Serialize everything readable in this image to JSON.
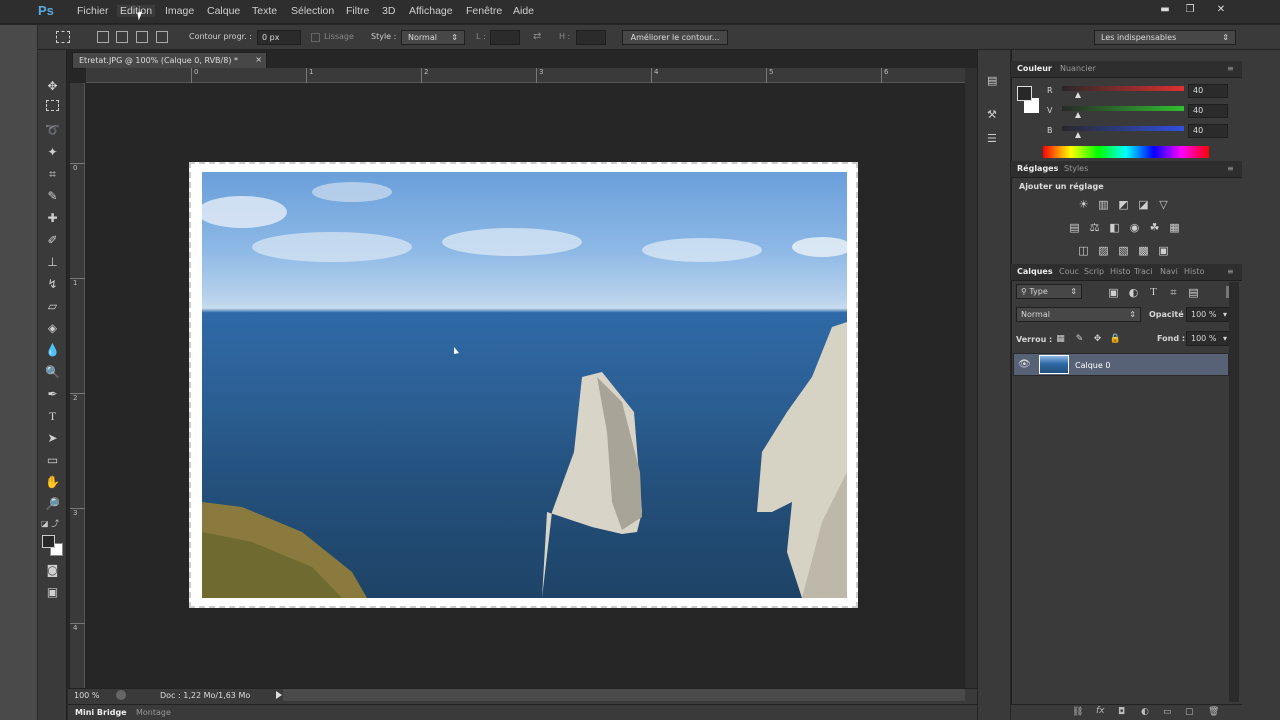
{
  "app": {
    "logo": "Ps"
  },
  "menu": [
    "Fichier",
    "Edition",
    "Image",
    "Calque",
    "Texte",
    "Sélection",
    "Filtre",
    "3D",
    "Affichage",
    "Fenêtre",
    "Aide"
  ],
  "window_controls": {
    "minimize": "▬",
    "restore": "❐",
    "close": "✕"
  },
  "options_bar": {
    "contour_label": "Contour progr. :",
    "contour_value": "0 px",
    "lissage_label": "Lissage",
    "style_label": "Style :",
    "style_value": "Normal",
    "l_label": "L :",
    "h_label": "H :",
    "refine_button": "Améliorer le contour...",
    "workspace_value": "Les indispensables"
  },
  "document": {
    "tab_title": "Etretat.JPG @ 100% (Calque 0, RVB/8) *",
    "tab_close": "×",
    "ruler_h": [
      "0",
      "1",
      "2",
      "3",
      "4",
      "5",
      "6"
    ],
    "ruler_v": [
      "0",
      "1",
      "2",
      "3",
      "4"
    ],
    "zoom": "100 %",
    "doc_info": "Doc : 1,22 Mo/1,63 Mo"
  },
  "bottom_tabs": [
    "Mini Bridge",
    "Montage"
  ],
  "color_panel": {
    "tabs": [
      "Couleur",
      "Nuancier"
    ],
    "channels": [
      {
        "label": "R",
        "value": "40",
        "color": "#e03030"
      },
      {
        "label": "V",
        "value": "40",
        "color": "#30c030"
      },
      {
        "label": "B",
        "value": "40",
        "color": "#3050e0"
      }
    ]
  },
  "adjust_panel": {
    "tabs": [
      "Réglages",
      "Styles"
    ],
    "heading": "Ajouter un réglage"
  },
  "layers_panel": {
    "tabs": [
      "Calques",
      "Couc",
      "Scrip",
      "Histo",
      "Traci",
      "Navi",
      "Histo"
    ],
    "filter_label": "Type",
    "blend_mode": "Normal",
    "opacity_label": "Opacité :",
    "opacity_value": "100 %",
    "lock_label": "Verrou :",
    "fill_label": "Fond :",
    "fill_value": "100 %",
    "layer_name": "Calque 0"
  }
}
